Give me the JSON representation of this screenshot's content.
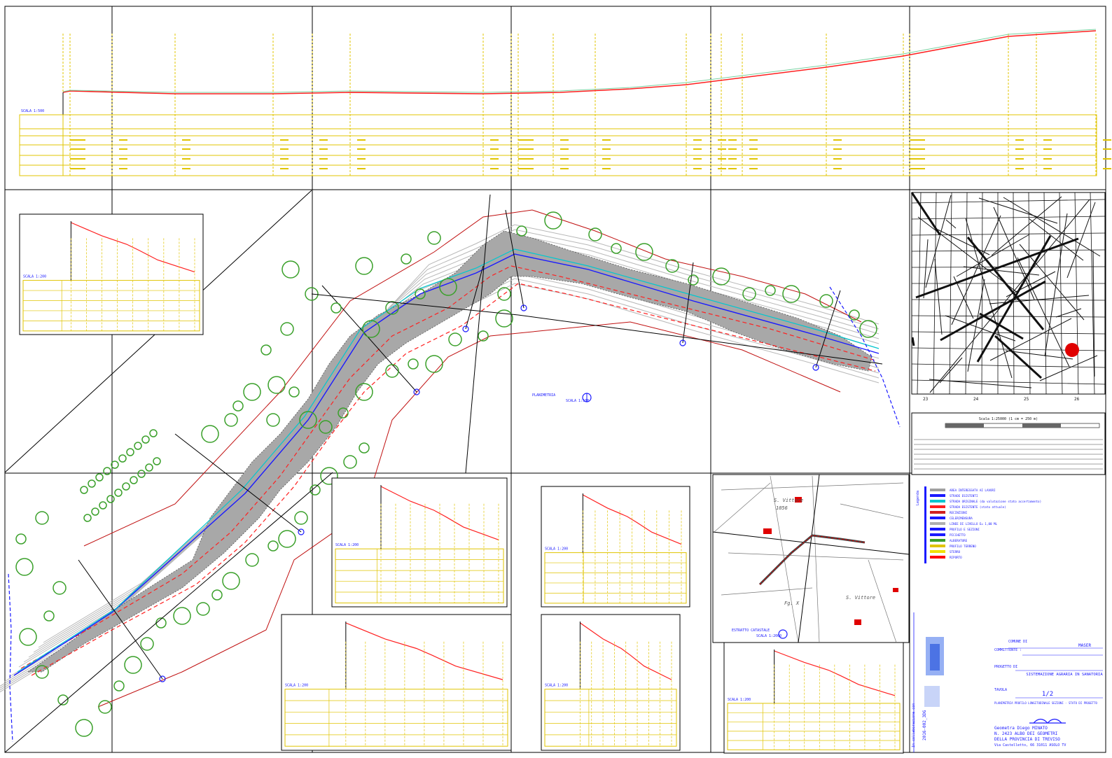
{
  "plan": {
    "title": "PLANIMETRIA",
    "scale": "SCALA 1:500"
  },
  "profiles": {
    "long_scale": "SCALA 1:500",
    "section_scale": "SCALA 1:200"
  },
  "map": {
    "coords_bottom": [
      "23",
      "24",
      "25",
      "26"
    ],
    "scale_text": "Scala 1:25000 (1 cm = 250 m)"
  },
  "cadastral": {
    "parcel_number": "1056",
    "place_name_top": "S. Vittore",
    "place_name_bottom": "S. Vittore",
    "sheet_label": "Fg. X",
    "title": "ESTRATTO CATASTALE",
    "scale": "SCALA 1:2000"
  },
  "legend": {
    "heading": "Legenda",
    "items": [
      {
        "label": "AREA INTERESSATA AI LAVORI",
        "color": "#a0a0a0"
      },
      {
        "label": "STRADE ESISTENTI",
        "color": "#1a1aff"
      },
      {
        "label": "STRADA ORIGINALE (da valutazione stato accertamento)",
        "color": "#00c8d0"
      },
      {
        "label": "STRADA ESISTENTE (stato attuale)",
        "color": "#ff2020"
      },
      {
        "label": "RECINZIONI",
        "color": "#d02020"
      },
      {
        "label": "CELERIMENSURA",
        "color": "#1a1aff"
      },
      {
        "label": "LINEE DI LIVELLO E= 1,00 ML",
        "color": "#b0b0b0"
      },
      {
        "label": "PROFILO E SEZIONI",
        "color": "#1a1aff"
      },
      {
        "label": "PICCHETTO",
        "color": "#1a1aff"
      },
      {
        "label": "ALBERATURE",
        "color": "#3aa02a"
      },
      {
        "label": "PROFILO TERRENO",
        "color": "#e0c400"
      },
      {
        "label": "STERRO",
        "color": "#f0e000"
      },
      {
        "label": "RIPORTO",
        "color": "#ff0000"
      }
    ]
  },
  "titleblock": {
    "comune_label": "COMUNE DI",
    "comune": "MASER",
    "committente_label": "COMMITTENTE :",
    "progetto_label": "PROGETTO DI",
    "progetto": "SISTEMAZIONE AGRARIA IN SANATORIA",
    "tavola_label": "TAVOLA",
    "tavola": "1/2",
    "tavola_desc": "PLANIMETRIA PROFILO LONGITUDINALE SEZIONI - STATO DI PROGETTO",
    "firm_name": "Geometra Diego MINATO",
    "firm_albo": "N. 2423 ALBO DEI GEOMETRI",
    "firm_provincia": "DELLA PROVINCIA DI TREVISO",
    "firm_address": "Via Castelletto, 66 31011 ASOLO TV",
    "file_code": "2016-002_3DG",
    "collab_label": "In collaborazione con"
  },
  "colors": {
    "grid": "#000000",
    "accent_blue": "#1a1aff",
    "yellow": "#e0c400",
    "terrain_red": "#ff2020",
    "tree_green": "#3aa02a",
    "work_area": "#a8a8a8"
  }
}
